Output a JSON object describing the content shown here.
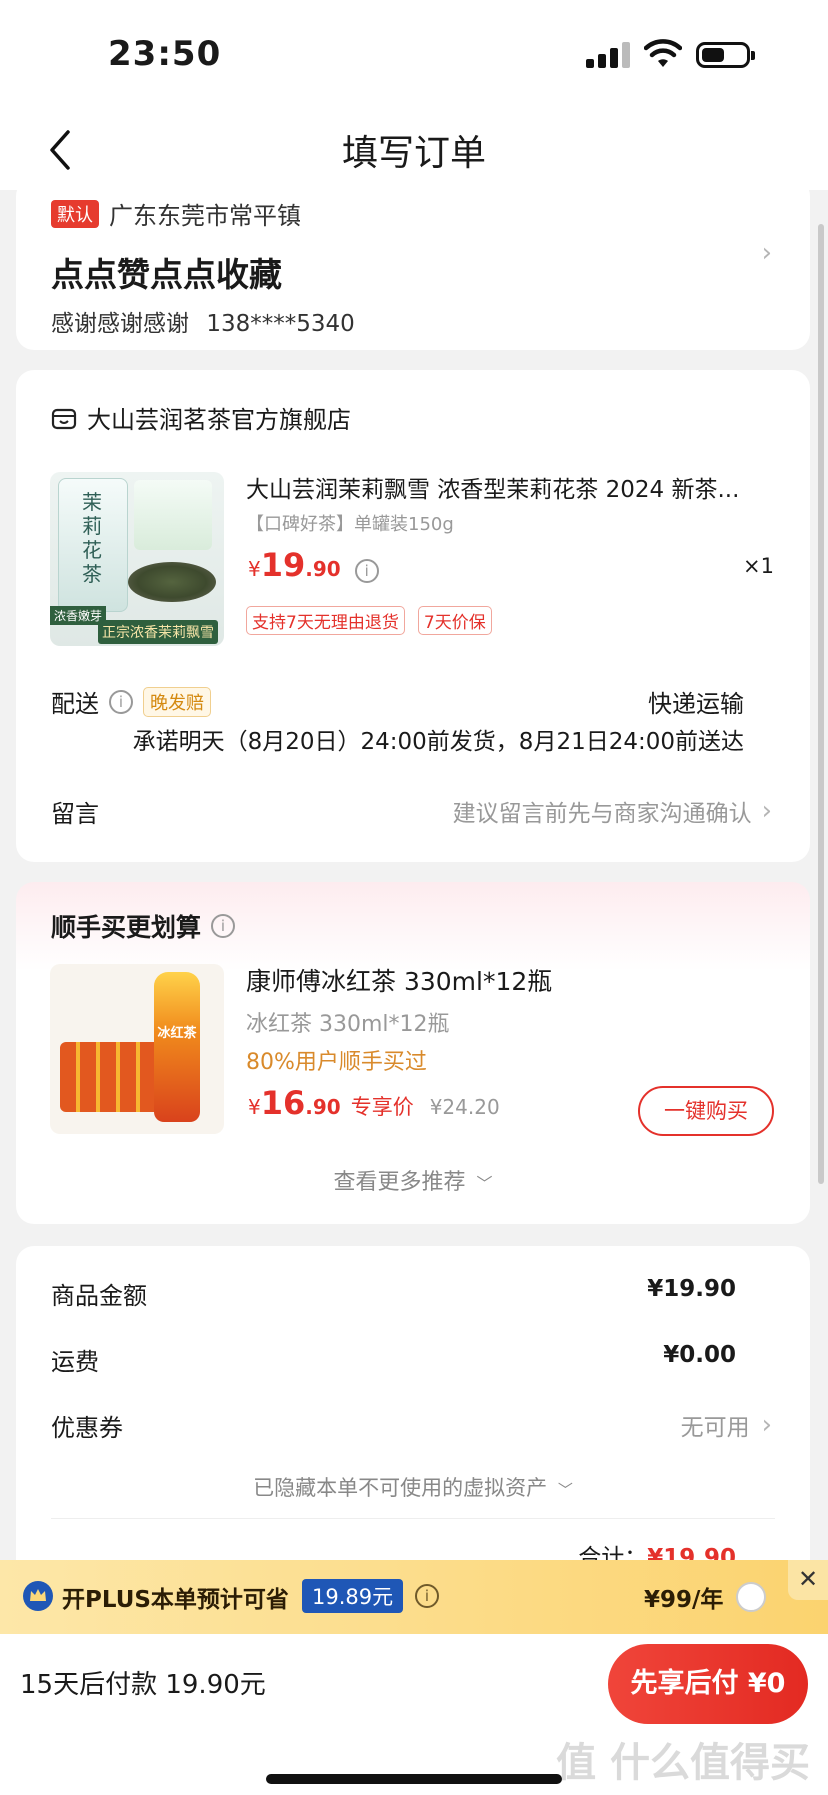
{
  "status_bar": {
    "time": "23:50"
  },
  "nav": {
    "title": "填写订单"
  },
  "address": {
    "default_tag": "默认",
    "region": "广东东莞市常平镇",
    "street": "点点赞点点收藏",
    "recipient": "感谢感谢感谢",
    "phone": "138****5340"
  },
  "shop": {
    "name": "大山芸润茗茶官方旗舰店",
    "product": {
      "thumb_top_text": "茉莉花茶",
      "thumb_badge": "浓香嫩芽",
      "thumb_caption": "正宗浓香茉莉飘雪",
      "title": "大山芸润茉莉飘雪 浓香型茉莉花茶 2024 新茶...",
      "spec": "【口碑好茶】单罐装150g",
      "price_symbol": "¥",
      "price_int": "19",
      "price_dec": ".90",
      "qty": "×1",
      "tags": [
        "支持7天无理由退货",
        "7天价保"
      ]
    },
    "delivery": {
      "label": "配送",
      "late_tag": "晚发赔",
      "method": "快递运输",
      "promise": "承诺明天（8月20日）24:00前发货，8月21日24:00前送达"
    },
    "note": {
      "label": "留言",
      "placeholder": "建议留言前先与商家沟通确认"
    }
  },
  "upsell": {
    "title": "顺手买更划算",
    "product": {
      "thumb_text": "冰红茶",
      "title": "康师傅冰红茶 330ml*12瓶",
      "subtitle": "冰红茶 330ml*12瓶",
      "stat": "80%用户顺手买过",
      "price_symbol": "¥",
      "price_int": "16",
      "price_dec": ".90",
      "price_label": "专享价",
      "original_price": "¥24.20",
      "buy_button": "一键购买"
    },
    "more": "查看更多推荐"
  },
  "summary": {
    "rows": [
      {
        "label": "商品金额",
        "value": "¥19.90"
      },
      {
        "label": "运费",
        "value": "¥0.00"
      },
      {
        "label": "优惠券",
        "value": "无可用"
      }
    ],
    "hidden_assets": "已隐藏本单不可使用的虚拟资产",
    "total_label": "合计：",
    "total_value": "¥19.90"
  },
  "plus_banner": {
    "text": "开PLUS本单预计可省",
    "saving": "19.89元",
    "price": "¥99/年"
  },
  "bottom_bar": {
    "pay_later_text": "15天后付款 19.90元",
    "button": "先享后付 ¥0"
  },
  "watermark": "值 什么值得买",
  "colors": {
    "accent": "#e4312b",
    "plus_bg": "#fbd87a",
    "plus_badge": "#1f57b6"
  }
}
